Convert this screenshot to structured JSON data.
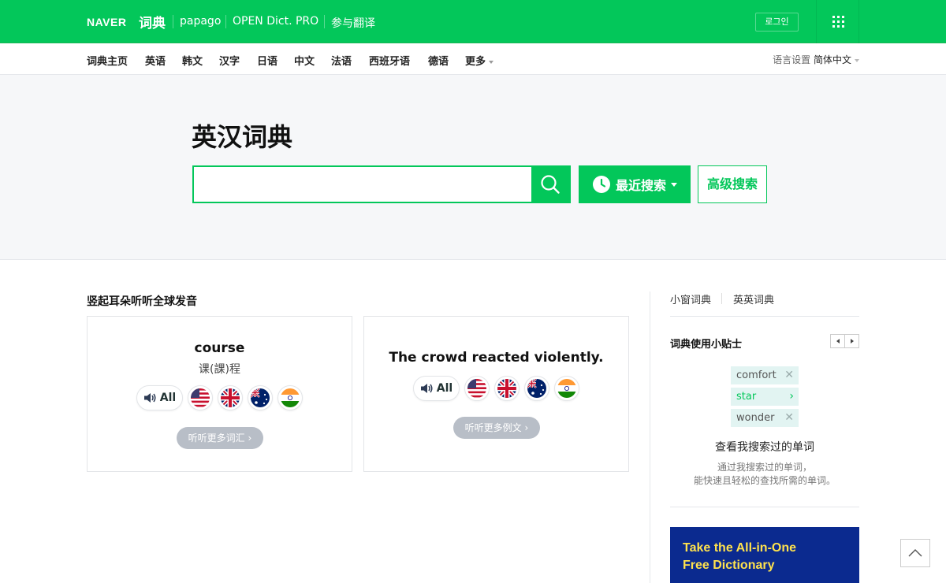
{
  "header": {
    "naver_logo": "NAVER",
    "dict_logo": "词典",
    "links": [
      "papago",
      "OPEN Dict. PRO",
      "参与翻译"
    ],
    "login_label": "로그인",
    "brand_color": "#03c75a"
  },
  "lang_nav": {
    "items": [
      "词典主页",
      "英语",
      "韩文",
      "汉字",
      "日语",
      "中文",
      "法语",
      "西班牙语",
      "德语",
      "更多"
    ],
    "setting_label": "语言设置",
    "setting_value": "简体中文"
  },
  "search": {
    "title": "英汉词典",
    "input_value": "",
    "recent_label": "最近搜索",
    "advanced_label": "高级搜索"
  },
  "pronunciation": {
    "section_title": "竖起耳朵听听全球发音",
    "all_label": "All",
    "flags": [
      "us-flag-icon",
      "uk-flag-icon",
      "au-flag-icon",
      "in-flag-icon"
    ],
    "cards": [
      {
        "word": "course",
        "meaning": "课(課)程",
        "more_label": "听听更多词汇"
      },
      {
        "sentence": "The crowd reacted violently.",
        "more_label": "听听更多例文"
      }
    ]
  },
  "sidebar": {
    "tabs": [
      "小窗词典",
      "英英词典"
    ],
    "tips_title": "词典使用小贴士",
    "chips": [
      {
        "word": "comfort",
        "action": "close"
      },
      {
        "word": "star",
        "action": "arrow"
      },
      {
        "word": "wonder",
        "action": "close"
      }
    ],
    "tips_heading": "查看我搜索过的单词",
    "tips_desc_line1": "通过我搜索过的单词，",
    "tips_desc_line2": "能快速且轻松的查找所需的单词。",
    "banner_line1": "Take the All-in-One",
    "banner_line2": "Free Dictionary"
  }
}
